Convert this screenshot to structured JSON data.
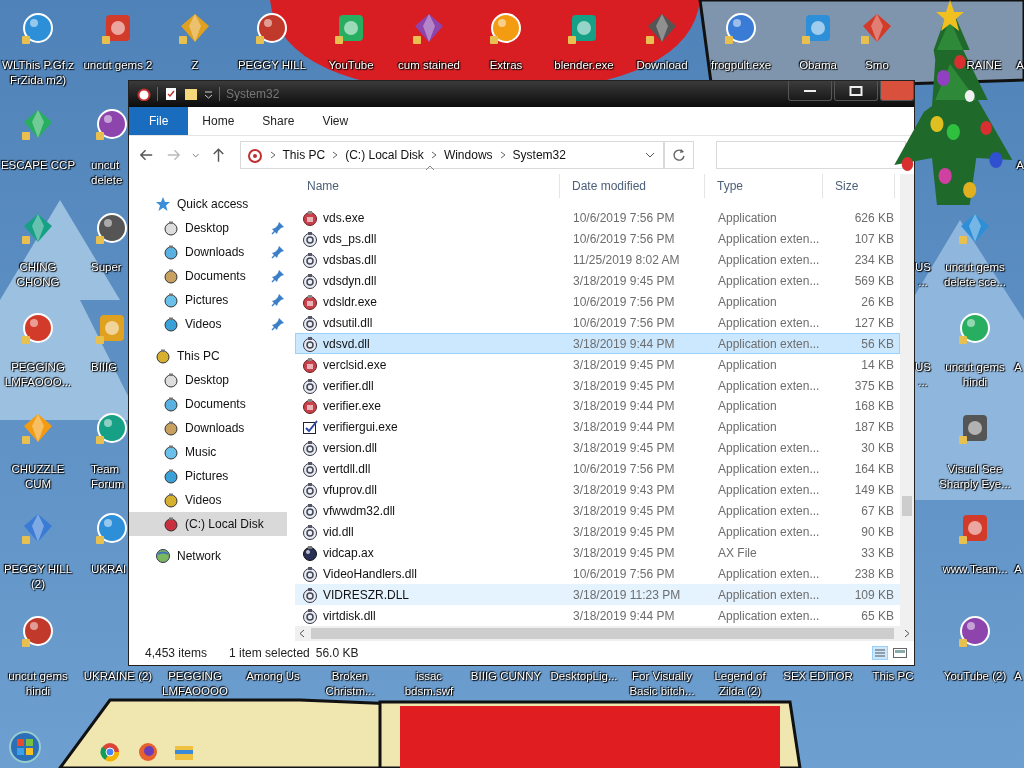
{
  "desktop_icons": [
    {
      "lines": [
        "WLThis P.Gf.z",
        "FrZida m2)"
      ]
    },
    {
      "lines": [
        "uncut gems 2"
      ]
    },
    {
      "lines": [
        "Z"
      ]
    },
    {
      "lines": [
        "PEGGY HILL"
      ]
    },
    {
      "lines": [
        "YouTube"
      ]
    },
    {
      "lines": [
        "cum stained"
      ]
    },
    {
      "lines": [
        "Extras"
      ]
    },
    {
      "lines": [
        "blender.exe"
      ]
    },
    {
      "lines": [
        "Download"
      ]
    },
    {
      "lines": [
        "frogpult.exe"
      ]
    },
    {
      "lines": [
        "Obama"
      ]
    },
    {
      "lines": [
        "Smo"
      ]
    },
    {
      "lines": [
        "RAINE"
      ]
    },
    {
      "lines": [
        "A"
      ]
    },
    {
      "lines": [
        "ESCAPE CCP"
      ]
    },
    {
      "lines": [
        "uncut",
        "delete"
      ]
    },
    {
      "lines": [
        "A"
      ]
    },
    {
      "lines": [
        "CHING",
        "CHONG"
      ]
    },
    {
      "lines": [
        "Super"
      ]
    },
    {
      "lines": [
        "US",
        "..."
      ]
    },
    {
      "lines": [
        "uncut gems",
        "delete sce..."
      ]
    },
    {
      "lines": [
        "PEGGING",
        "LMFAOOO..."
      ]
    },
    {
      "lines": [
        "BIIIG"
      ]
    },
    {
      "lines": [
        "US",
        "..."
      ]
    },
    {
      "lines": [
        "uncut gems",
        "hindi"
      ]
    },
    {
      "lines": [
        "A"
      ]
    },
    {
      "lines": [
        "CHUZZLE",
        "CUM"
      ]
    },
    {
      "lines": [
        "Team",
        "Forum"
      ]
    },
    {
      "lines": [
        "Visual See",
        "Sharply Eye..."
      ]
    },
    {
      "lines": [
        "PEGGY HILL",
        "(2)"
      ]
    },
    {
      "lines": [
        "UKRAI"
      ]
    },
    {
      "lines": [
        "www.Team..."
      ]
    },
    {
      "lines": [
        "A"
      ]
    },
    {
      "lines": [
        "uncut gems",
        "hindi"
      ]
    },
    {
      "lines": [
        "UKRAINE (2)"
      ]
    },
    {
      "lines": [
        "PEGGING",
        "LMFAOOOO"
      ]
    },
    {
      "lines": [
        "Among Us"
      ]
    },
    {
      "lines": [
        "Broken",
        "Christm..."
      ]
    },
    {
      "lines": [
        "issac",
        "bdsm.swf"
      ]
    },
    {
      "lines": [
        "BIIIG CUNNY"
      ]
    },
    {
      "lines": [
        "DesktopLig..."
      ]
    },
    {
      "lines": [
        "For Visually",
        "Basic bitch..."
      ]
    },
    {
      "lines": [
        "Legend of",
        "Zilda (2)"
      ]
    },
    {
      "lines": [
        "SEX EDITOR"
      ]
    },
    {
      "lines": [
        "This PC"
      ]
    },
    {
      "lines": [
        "YouTube (2)"
      ]
    },
    {
      "lines": [
        "A"
      ]
    }
  ],
  "window": {
    "title": "System32",
    "ribbon_tabs": [
      {
        "label": "File",
        "selected": true
      },
      {
        "label": "Home",
        "selected": false
      },
      {
        "label": "Share",
        "selected": false
      },
      {
        "label": "View",
        "selected": false
      }
    ],
    "address": [
      "This PC",
      "(C:) Local Disk",
      "Windows",
      "System32"
    ],
    "nav": [
      {
        "label": "Quick access",
        "selected": false,
        "children": [
          {
            "label": "Desktop",
            "selected": false,
            "pinned": true
          },
          {
            "label": "Downloads",
            "selected": false,
            "pinned": true
          },
          {
            "label": "Documents",
            "selected": false,
            "pinned": true
          },
          {
            "label": "Pictures",
            "selected": false,
            "pinned": true
          },
          {
            "label": "Videos",
            "selected": false,
            "pinned": true
          }
        ]
      },
      {
        "label": "This PC",
        "selected": false,
        "children": [
          {
            "label": "Desktop",
            "selected": false,
            "pinned": false
          },
          {
            "label": "Documents",
            "selected": false,
            "pinned": false
          },
          {
            "label": "Downloads",
            "selected": false,
            "pinned": false
          },
          {
            "label": "Music",
            "selected": false,
            "pinned": false
          },
          {
            "label": "Pictures",
            "selected": false,
            "pinned": false
          },
          {
            "label": "Videos",
            "selected": false,
            "pinned": false
          },
          {
            "label": "(C:) Local Disk",
            "selected": true,
            "pinned": false
          }
        ]
      },
      {
        "label": "Network",
        "selected": false
      }
    ],
    "columns": [
      "Name",
      "Date modified",
      "Type",
      "Size"
    ],
    "files": [
      {
        "kind": "exe",
        "name": "vds.exe",
        "date": "10/6/2019 7:56 PM",
        "type": "Application",
        "size": "626 KB",
        "selected": false,
        "hovered": false
      },
      {
        "kind": "dll",
        "name": "vds_ps.dll",
        "date": "10/6/2019 7:56 PM",
        "type": "Application exten...",
        "size": "107 KB",
        "selected": false,
        "hovered": false
      },
      {
        "kind": "dll",
        "name": "vdsbas.dll",
        "date": "11/25/2019 8:02 AM",
        "type": "Application exten...",
        "size": "234 KB",
        "selected": false,
        "hovered": false
      },
      {
        "kind": "dll",
        "name": "vdsdyn.dll",
        "date": "3/18/2019 9:45 PM",
        "type": "Application exten...",
        "size": "569 KB",
        "selected": false,
        "hovered": false
      },
      {
        "kind": "exe",
        "name": "vdsldr.exe",
        "date": "10/6/2019 7:56 PM",
        "type": "Application",
        "size": "26 KB",
        "selected": false,
        "hovered": false
      },
      {
        "kind": "dll",
        "name": "vdsutil.dll",
        "date": "10/6/2019 7:56 PM",
        "type": "Application exten...",
        "size": "127 KB",
        "selected": false,
        "hovered": false
      },
      {
        "kind": "dll",
        "name": "vdsvd.dll",
        "date": "3/18/2019 9:44 PM",
        "type": "Application exten...",
        "size": "56 KB",
        "selected": true,
        "hovered": false
      },
      {
        "kind": "exe",
        "name": "verclsid.exe",
        "date": "3/18/2019 9:45 PM",
        "type": "Application",
        "size": "14 KB",
        "selected": false,
        "hovered": false
      },
      {
        "kind": "dll",
        "name": "verifier.dll",
        "date": "3/18/2019 9:45 PM",
        "type": "Application exten...",
        "size": "375 KB",
        "selected": false,
        "hovered": false
      },
      {
        "kind": "exe",
        "name": "verifier.exe",
        "date": "3/18/2019 9:44 PM",
        "type": "Application",
        "size": "168 KB",
        "selected": false,
        "hovered": false
      },
      {
        "kind": "gui",
        "name": "verifiergui.exe",
        "date": "3/18/2019 9:44 PM",
        "type": "Application",
        "size": "187 KB",
        "selected": false,
        "hovered": false
      },
      {
        "kind": "dll",
        "name": "version.dll",
        "date": "3/18/2019 9:45 PM",
        "type": "Application exten...",
        "size": "30 KB",
        "selected": false,
        "hovered": false
      },
      {
        "kind": "dll",
        "name": "vertdll.dll",
        "date": "10/6/2019 7:56 PM",
        "type": "Application exten...",
        "size": "164 KB",
        "selected": false,
        "hovered": false
      },
      {
        "kind": "dll",
        "name": "vfuprov.dll",
        "date": "3/18/2019 9:43 PM",
        "type": "Application exten...",
        "size": "149 KB",
        "selected": false,
        "hovered": false
      },
      {
        "kind": "dll",
        "name": "vfwwdm32.dll",
        "date": "3/18/2019 9:45 PM",
        "type": "Application exten...",
        "size": "67 KB",
        "selected": false,
        "hovered": false
      },
      {
        "kind": "dll",
        "name": "vid.dll",
        "date": "3/18/2019 9:45 PM",
        "type": "Application exten...",
        "size": "90 KB",
        "selected": false,
        "hovered": false
      },
      {
        "kind": "ax",
        "name": "vidcap.ax",
        "date": "3/18/2019 9:45 PM",
        "type": "AX File",
        "size": "33 KB",
        "selected": false,
        "hovered": false
      },
      {
        "kind": "dll",
        "name": "VideoHandlers.dll",
        "date": "10/6/2019 7:56 PM",
        "type": "Application exten...",
        "size": "238 KB",
        "selected": false,
        "hovered": false
      },
      {
        "kind": "dll",
        "name": "VIDRESZR.DLL",
        "date": "3/18/2019 11:23 PM",
        "type": "Application exten...",
        "size": "109 KB",
        "selected": false,
        "hovered": true
      },
      {
        "kind": "dll",
        "name": "virtdisk.dll",
        "date": "3/18/2019 9:44 PM",
        "type": "Application exten...",
        "size": "65 KB",
        "selected": false,
        "hovered": false
      }
    ],
    "status": {
      "count": "4,453 items",
      "selection": "1 item selected",
      "selection_size": "56.0 KB"
    }
  }
}
